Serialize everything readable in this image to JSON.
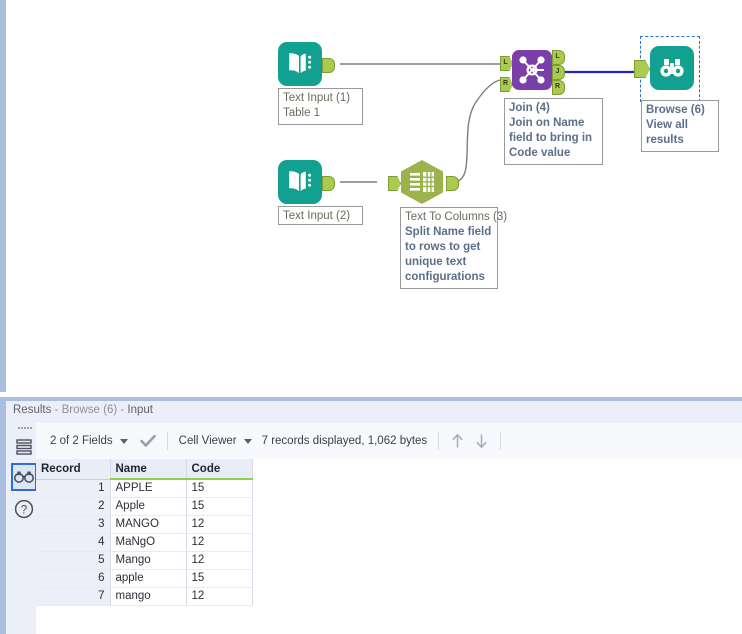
{
  "canvas": {
    "nodes": [
      {
        "id": "text-input-1",
        "icon": "book-icon",
        "title": "Text Input (1)",
        "annotation": "Table 1",
        "selected": false
      },
      {
        "id": "text-input-2",
        "icon": "book-icon",
        "title": "Text Input (2)",
        "annotation": "",
        "selected": false
      },
      {
        "id": "text-to-columns-3",
        "icon": "table-grid-icon",
        "title": "Text To Columns (3)",
        "annotation": "Split Name field to rows to get unique text configurations",
        "selected": false
      },
      {
        "id": "join-4",
        "icon": "join-network-icon",
        "title": "Join (4)",
        "annotation": "Join on Name field to bring in Code value",
        "selected": false
      },
      {
        "id": "browse-6",
        "icon": "binoculars-icon",
        "title": "Browse (6)",
        "annotation": "View all results",
        "selected": true
      }
    ],
    "anchors": {
      "join_inputs": [
        "L",
        "R"
      ],
      "join_outputs": [
        "L",
        "J",
        "R"
      ]
    },
    "colors": {
      "text_input": "#12a191",
      "text_to_columns": "#9cb24c",
      "join": "#7a3fa8",
      "browse": "#12a191",
      "anchor": "#aacb52",
      "wire": "#7d7d7d",
      "wire_selected": "#2222cc",
      "selection": "#2a6ed6"
    }
  },
  "results": {
    "title_prefix": "Results",
    "title_node": "- Browse (6) -",
    "title_suffix": "Input",
    "sidebar": [
      {
        "name": "records-list-icon",
        "label": "Records"
      },
      {
        "name": "binoculars-icon",
        "label": "Browse"
      },
      {
        "name": "help-question-icon",
        "label": "Help"
      }
    ],
    "toolbar": {
      "fields_label": "2 of 2 Fields",
      "check_icon": "checkmark-icon",
      "view_mode": "Cell Viewer",
      "record_info": "7 records displayed, 1,062 bytes",
      "nav_up_icon": "arrow-up-icon",
      "nav_down_icon": "arrow-down-icon"
    },
    "table": {
      "columns": [
        "Record",
        "Name",
        "Code"
      ],
      "rows": [
        [
          "1",
          "APPLE",
          "15"
        ],
        [
          "2",
          "Apple",
          "15"
        ],
        [
          "3",
          "MANGO",
          "12"
        ],
        [
          "4",
          "MaNgO",
          "12"
        ],
        [
          "5",
          "Mango",
          "12"
        ],
        [
          "6",
          "apple",
          "15"
        ],
        [
          "7",
          "mango",
          "12"
        ]
      ]
    }
  }
}
